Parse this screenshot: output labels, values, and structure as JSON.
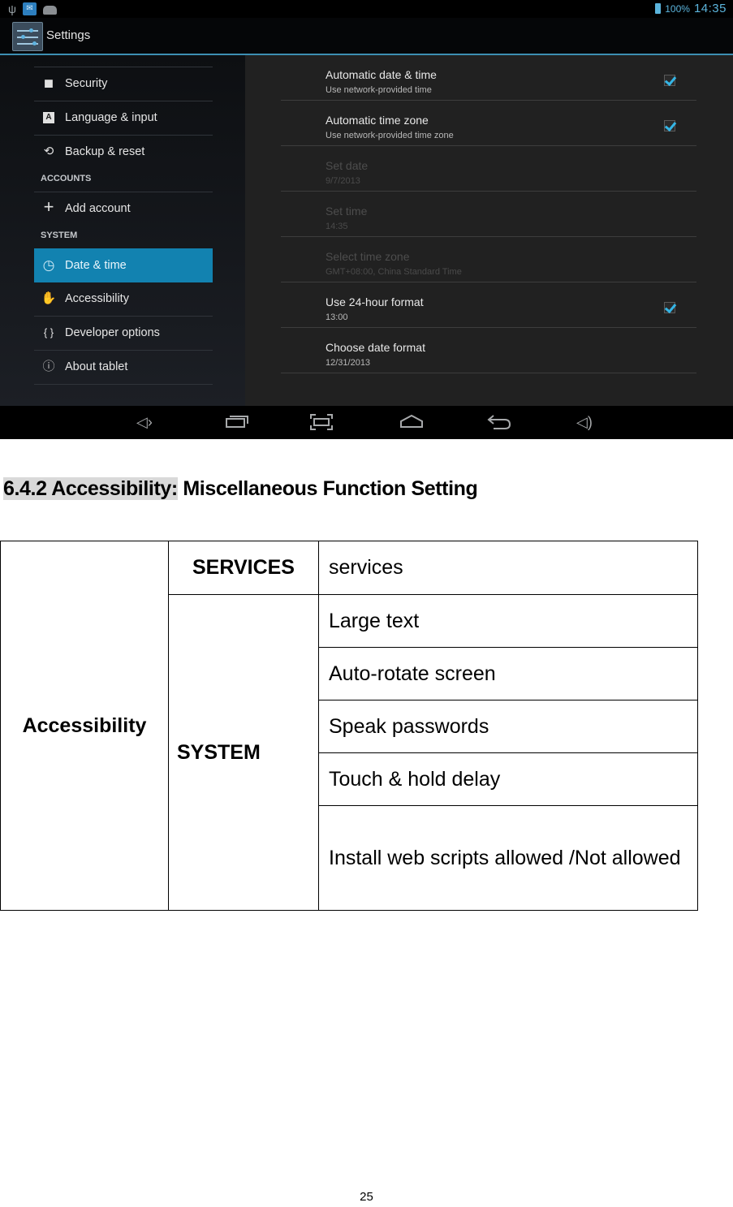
{
  "statusbar": {
    "left_icons": [
      "usb-icon",
      "mail-icon",
      "android-bot-icon"
    ],
    "battery_icon": "battery-charging-icon",
    "battery_percent": "100%",
    "time": "14:35"
  },
  "actionbar": {
    "app_icon": "settings-sliders-icon",
    "title": "Settings"
  },
  "sidebar": {
    "items_top": [
      {
        "icon": "lock-icon",
        "glyph": "🔒",
        "label": "Security"
      },
      {
        "icon": "language-icon",
        "glyph": "A",
        "label": "Language & input"
      },
      {
        "icon": "backup-restore-icon",
        "glyph": "⟲",
        "label": "Backup & reset"
      }
    ],
    "accounts_header": "ACCOUNTS",
    "accounts_items": [
      {
        "icon": "add-icon",
        "glyph": "+",
        "label": "Add account"
      }
    ],
    "system_header": "SYSTEM",
    "system_items": [
      {
        "icon": "clock-icon",
        "glyph": "◷",
        "label": "Date & time",
        "active": true
      },
      {
        "icon": "hand-icon",
        "glyph": "✋",
        "label": "Accessibility"
      },
      {
        "icon": "braces-icon",
        "glyph": "{ }",
        "label": "Developer options"
      },
      {
        "icon": "info-icon",
        "glyph": "ⓘ",
        "label": "About tablet"
      }
    ]
  },
  "detail": {
    "items": [
      {
        "title": "Automatic date & time",
        "summary": "Use network-provided time",
        "checked": true,
        "enabled": true
      },
      {
        "title": "Automatic time zone",
        "summary": "Use network-provided time zone",
        "checked": true,
        "enabled": true
      },
      {
        "title": "Set date",
        "summary": "9/7/2013",
        "enabled": false
      },
      {
        "title": "Set time",
        "summary": "14:35",
        "enabled": false
      },
      {
        "title": "Select time zone",
        "summary": "GMT+08:00, China Standard Time",
        "enabled": false
      },
      {
        "title": "Use 24-hour format",
        "summary": "13:00",
        "checked": true,
        "enabled": true
      },
      {
        "title": "Choose date format",
        "summary": "12/31/2013",
        "enabled": true
      }
    ]
  },
  "navbar": {
    "buttons": [
      {
        "icon": "volume-down-icon",
        "glyph": "🔈"
      },
      {
        "icon": "recent-apps-icon",
        "glyph": "▭"
      },
      {
        "icon": "screenshot-icon",
        "glyph": "⛶"
      },
      {
        "icon": "home-icon",
        "glyph": "⌂"
      },
      {
        "icon": "back-icon",
        "glyph": "↩"
      },
      {
        "icon": "volume-up-icon",
        "glyph": "🔊"
      }
    ]
  },
  "document": {
    "heading_highlighted": "6.4.2 Accessibility:",
    "heading_rest": " Miscellaneous Function Setting",
    "table": {
      "category": "Accessibility",
      "groups": [
        {
          "name": "SERVICES",
          "items": [
            "services"
          ]
        },
        {
          "name": "SYSTEM",
          "items": [
            "Large text",
            "Auto-rotate screen",
            "Speak passwords",
            "Touch & hold delay",
            "Install web scripts allowed /Not allowed"
          ]
        }
      ]
    },
    "page_number": "25"
  }
}
